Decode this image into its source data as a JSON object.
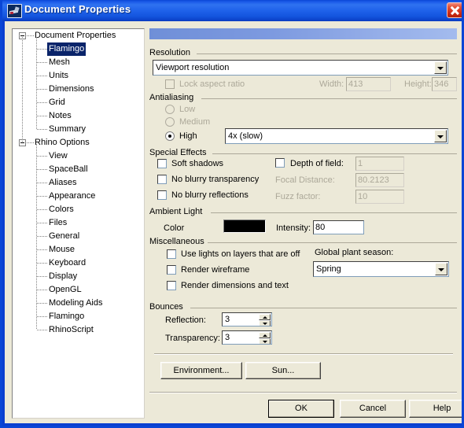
{
  "window": {
    "title": "Document Properties",
    "icon": "rhino-app-icon",
    "close_label": "Close"
  },
  "tree": {
    "nodes": [
      {
        "label": "Document Properties",
        "level": "root",
        "expanded": true,
        "selected": false
      },
      {
        "label": "Flamingo",
        "level": "child",
        "selected": true
      },
      {
        "label": "Mesh",
        "level": "child",
        "selected": false
      },
      {
        "label": "Units",
        "level": "child",
        "selected": false
      },
      {
        "label": "Dimensions",
        "level": "child",
        "selected": false
      },
      {
        "label": "Grid",
        "level": "child",
        "selected": false
      },
      {
        "label": "Notes",
        "level": "child",
        "selected": false
      },
      {
        "label": "Summary",
        "level": "child",
        "selected": false
      },
      {
        "label": "Rhino Options",
        "level": "root",
        "expanded": true,
        "selected": false
      },
      {
        "label": "View",
        "level": "child",
        "selected": false
      },
      {
        "label": "SpaceBall",
        "level": "child",
        "selected": false
      },
      {
        "label": "Aliases",
        "level": "child",
        "selected": false
      },
      {
        "label": "Appearance",
        "level": "child",
        "selected": false
      },
      {
        "label": "Colors",
        "level": "child",
        "selected": false
      },
      {
        "label": "Files",
        "level": "child",
        "selected": false
      },
      {
        "label": "General",
        "level": "child",
        "selected": false
      },
      {
        "label": "Mouse",
        "level": "child",
        "selected": false
      },
      {
        "label": "Keyboard",
        "level": "child",
        "selected": false
      },
      {
        "label": "Display",
        "level": "child",
        "selected": false
      },
      {
        "label": "OpenGL",
        "level": "child",
        "selected": false
      },
      {
        "label": "Modeling Aids",
        "level": "child",
        "selected": false
      },
      {
        "label": "Flamingo",
        "level": "child",
        "selected": false
      },
      {
        "label": "RhinoScript",
        "level": "child",
        "selected": false
      }
    ]
  },
  "resolution": {
    "group_label": "Resolution",
    "preset_value": "Viewport resolution",
    "lock_aspect_label": "Lock aspect ratio",
    "lock_aspect_checked": false,
    "width_label": "Width:",
    "width_value": "413",
    "height_label": "Height:",
    "height_value": "346"
  },
  "antialiasing": {
    "group_label": "Antialiasing",
    "options": [
      {
        "label": "Low",
        "selected": false,
        "disabled": true
      },
      {
        "label": "Medium",
        "selected": false,
        "disabled": true
      },
      {
        "label": "High",
        "selected": true,
        "disabled": false
      }
    ],
    "quality_value": "4x (slow)"
  },
  "special_effects": {
    "group_label": "Special Effects",
    "soft_shadows_label": "Soft shadows",
    "soft_shadows_checked": false,
    "no_blurry_transparency_label": "No blurry transparency",
    "no_blurry_transparency_checked": false,
    "no_blurry_reflections_label": "No blurry reflections",
    "no_blurry_reflections_checked": false,
    "depth_of_field_label": "Depth of field:",
    "depth_of_field_checked": false,
    "depth_of_field_value": "1",
    "focal_distance_label": "Focal Distance:",
    "focal_distance_value": "80.2123",
    "fuzz_factor_label": "Fuzz factor:",
    "fuzz_factor_value": "10"
  },
  "ambient_light": {
    "group_label": "Ambient Light",
    "color_label": "Color",
    "color_value": "#000000",
    "intensity_label": "Intensity:",
    "intensity_value": "80"
  },
  "miscellaneous": {
    "group_label": "Miscellaneous",
    "use_lights_label": "Use lights on layers that are off",
    "use_lights_checked": false,
    "render_wireframe_label": "Render wireframe",
    "render_wireframe_checked": false,
    "render_dimensions_label": "Render dimensions and text",
    "render_dimensions_checked": false,
    "season_label": "Global plant season:",
    "season_value": "Spring"
  },
  "bounces": {
    "group_label": "Bounces",
    "reflection_label": "Reflection:",
    "reflection_value": "3",
    "transparency_label": "Transparency:",
    "transparency_value": "3"
  },
  "actions": {
    "environment_label": "Environment...",
    "sun_label": "Sun..."
  },
  "dialog_buttons": {
    "ok_label": "OK",
    "cancel_label": "Cancel",
    "help_label": "Help"
  }
}
